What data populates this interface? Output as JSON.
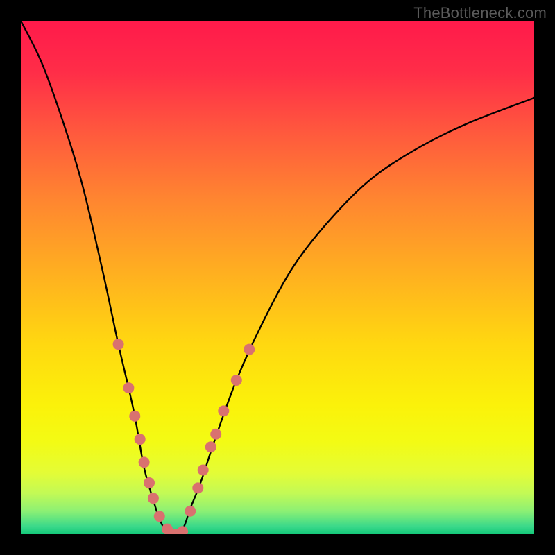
{
  "watermark": "TheBottleneck.com",
  "chart_data": {
    "type": "line",
    "title": "",
    "xlabel": "",
    "ylabel": "",
    "xlim": [
      0,
      100
    ],
    "ylim": [
      0,
      100
    ],
    "curve": {
      "name": "bottleneck_curve",
      "x": [
        0,
        4,
        8,
        12,
        16,
        19,
        22,
        24,
        26,
        27,
        28,
        29,
        30,
        31,
        32,
        33,
        35,
        38,
        42,
        47,
        53,
        60,
        68,
        77,
        87,
        100
      ],
      "y": [
        100,
        92,
        81,
        68,
        51,
        37,
        24,
        13,
        6,
        3,
        1,
        0,
        0,
        0,
        2,
        5,
        10,
        19,
        30,
        41,
        52,
        61,
        69,
        75,
        80,
        85
      ]
    },
    "marker_series": {
      "name": "marker_points",
      "color": "#d9716f",
      "radius_px": 8,
      "points": [
        {
          "x": 19.0,
          "y": 37.0
        },
        {
          "x": 21.0,
          "y": 28.5
        },
        {
          "x": 22.2,
          "y": 23.0
        },
        {
          "x": 23.2,
          "y": 18.5
        },
        {
          "x": 24.0,
          "y": 14.0
        },
        {
          "x": 25.0,
          "y": 10.0
        },
        {
          "x": 25.8,
          "y": 7.0
        },
        {
          "x": 27.0,
          "y": 3.5
        },
        {
          "x": 28.5,
          "y": 1.0
        },
        {
          "x": 29.5,
          "y": 0.0
        },
        {
          "x": 30.5,
          "y": 0.0
        },
        {
          "x": 31.5,
          "y": 0.5
        },
        {
          "x": 33.0,
          "y": 4.5
        },
        {
          "x": 34.5,
          "y": 9.0
        },
        {
          "x": 35.5,
          "y": 12.5
        },
        {
          "x": 37.0,
          "y": 17.0
        },
        {
          "x": 38.0,
          "y": 19.5
        },
        {
          "x": 39.5,
          "y": 24.0
        },
        {
          "x": 42.0,
          "y": 30.0
        },
        {
          "x": 44.5,
          "y": 36.0
        }
      ]
    },
    "gradient": {
      "stops": [
        {
          "pos": 0.0,
          "color": "#ff1a4b"
        },
        {
          "pos": 0.1,
          "color": "#ff2d48"
        },
        {
          "pos": 0.22,
          "color": "#ff5a3d"
        },
        {
          "pos": 0.35,
          "color": "#ff8630"
        },
        {
          "pos": 0.5,
          "color": "#ffb21f"
        },
        {
          "pos": 0.63,
          "color": "#ffd810"
        },
        {
          "pos": 0.75,
          "color": "#fbf20a"
        },
        {
          "pos": 0.82,
          "color": "#f3fb14"
        },
        {
          "pos": 0.88,
          "color": "#e4fc36"
        },
        {
          "pos": 0.92,
          "color": "#c3fa55"
        },
        {
          "pos": 0.955,
          "color": "#8cf074"
        },
        {
          "pos": 0.985,
          "color": "#3ad98a"
        },
        {
          "pos": 1.0,
          "color": "#14c97a"
        }
      ]
    }
  }
}
